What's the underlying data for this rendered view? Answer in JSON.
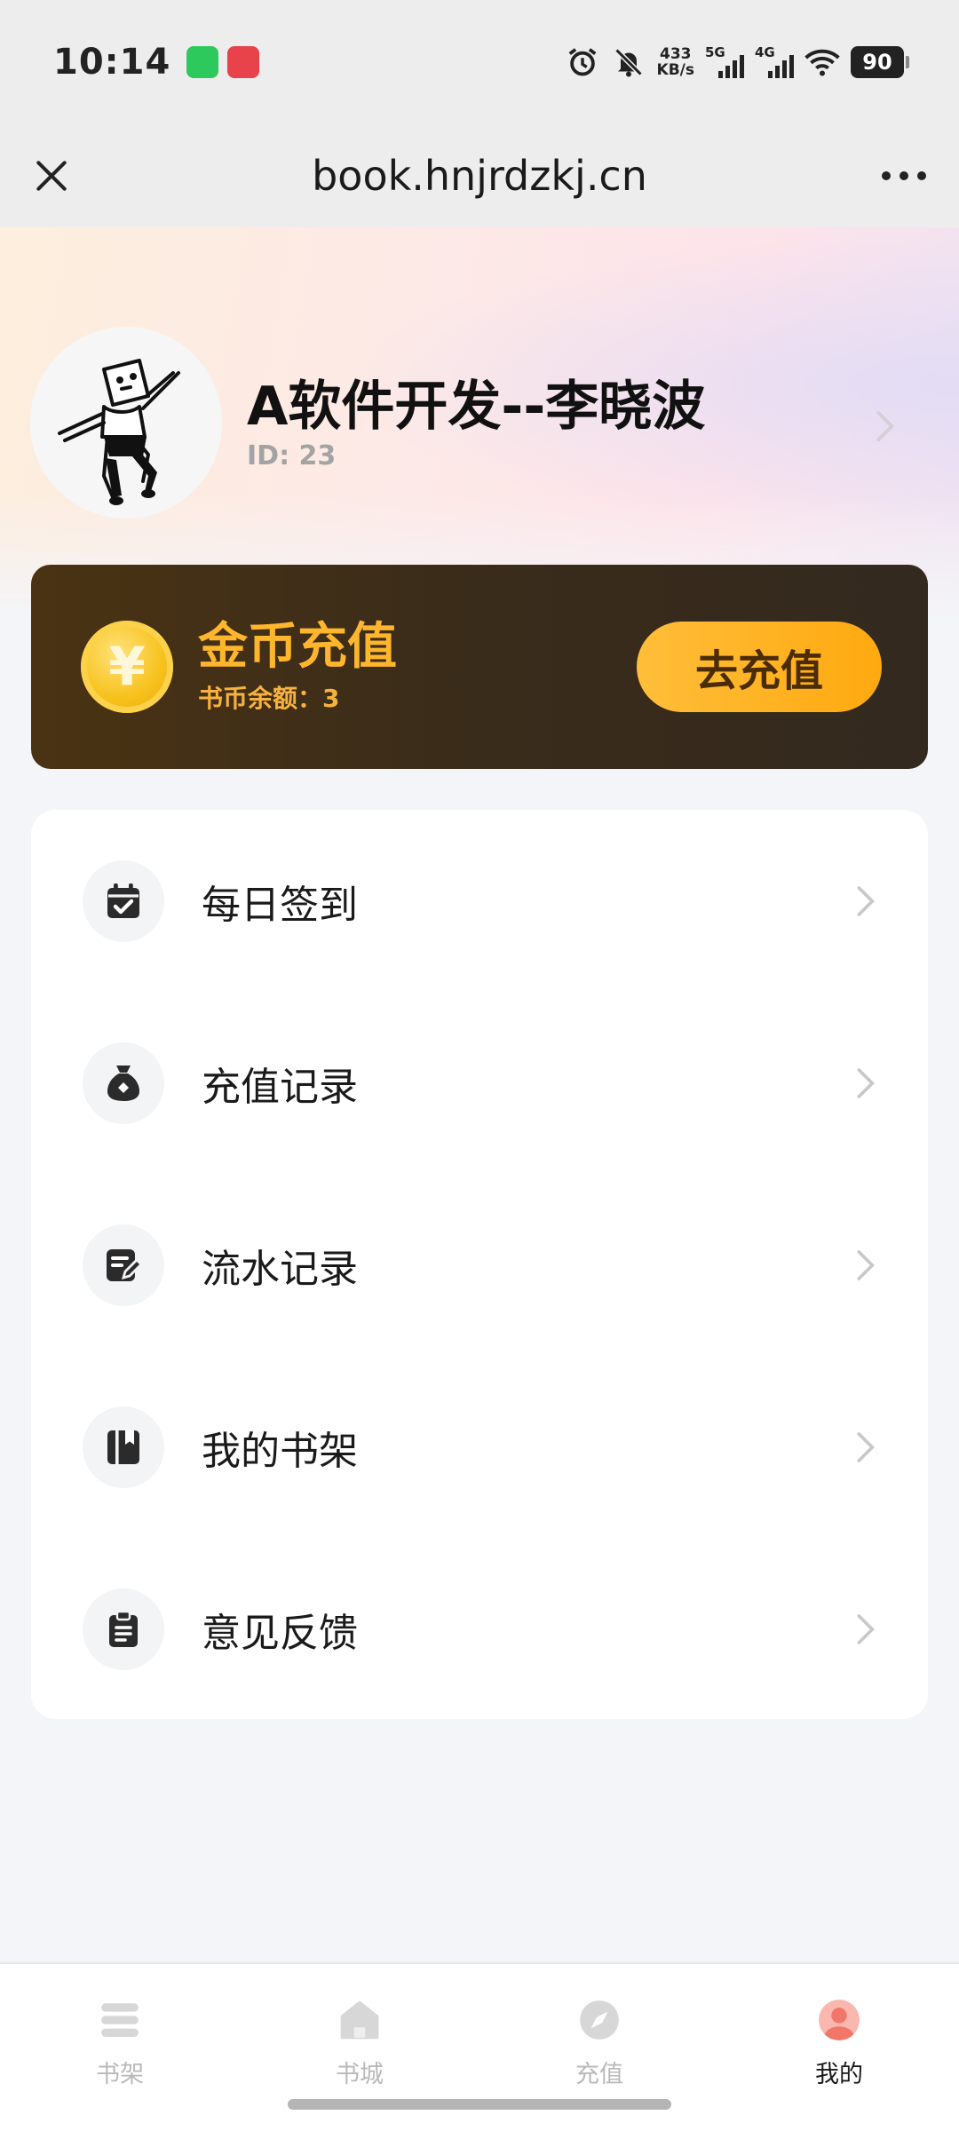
{
  "status_bar": {
    "time": "10:14",
    "net_speed_value": "433",
    "net_speed_unit": "KB/s",
    "signal1_label": "5G",
    "signal2_label": "4G",
    "battery": "90"
  },
  "title_bar": {
    "url": "book.hnjrdzkj.cn"
  },
  "profile": {
    "name": "A软件开发--李晓波",
    "id": "ID: 23"
  },
  "coin_card": {
    "title": "金币充值",
    "balance": "书币余额：3",
    "button_label": "去充值"
  },
  "menu": {
    "items": [
      {
        "label": "每日签到",
        "icon": "calendar-check-icon"
      },
      {
        "label": "充值记录",
        "icon": "money-bag-icon"
      },
      {
        "label": "流水记录",
        "icon": "edit-document-icon"
      },
      {
        "label": "我的书架",
        "icon": "book-icon"
      },
      {
        "label": "意见反馈",
        "icon": "clipboard-icon"
      }
    ]
  },
  "bottom_nav": {
    "items": [
      {
        "label": "书架",
        "icon": "bookshelf-icon",
        "active": false
      },
      {
        "label": "书城",
        "icon": "home-icon",
        "active": false
      },
      {
        "label": "充值",
        "icon": "compass-icon",
        "active": false
      },
      {
        "label": "我的",
        "icon": "profile-icon",
        "active": true
      }
    ]
  },
  "colors": {
    "accent_orange": "#ffa90f",
    "coin_text": "#ffb62c",
    "card_dark": "#3b2c1a",
    "active_profile": "#f2776a"
  }
}
